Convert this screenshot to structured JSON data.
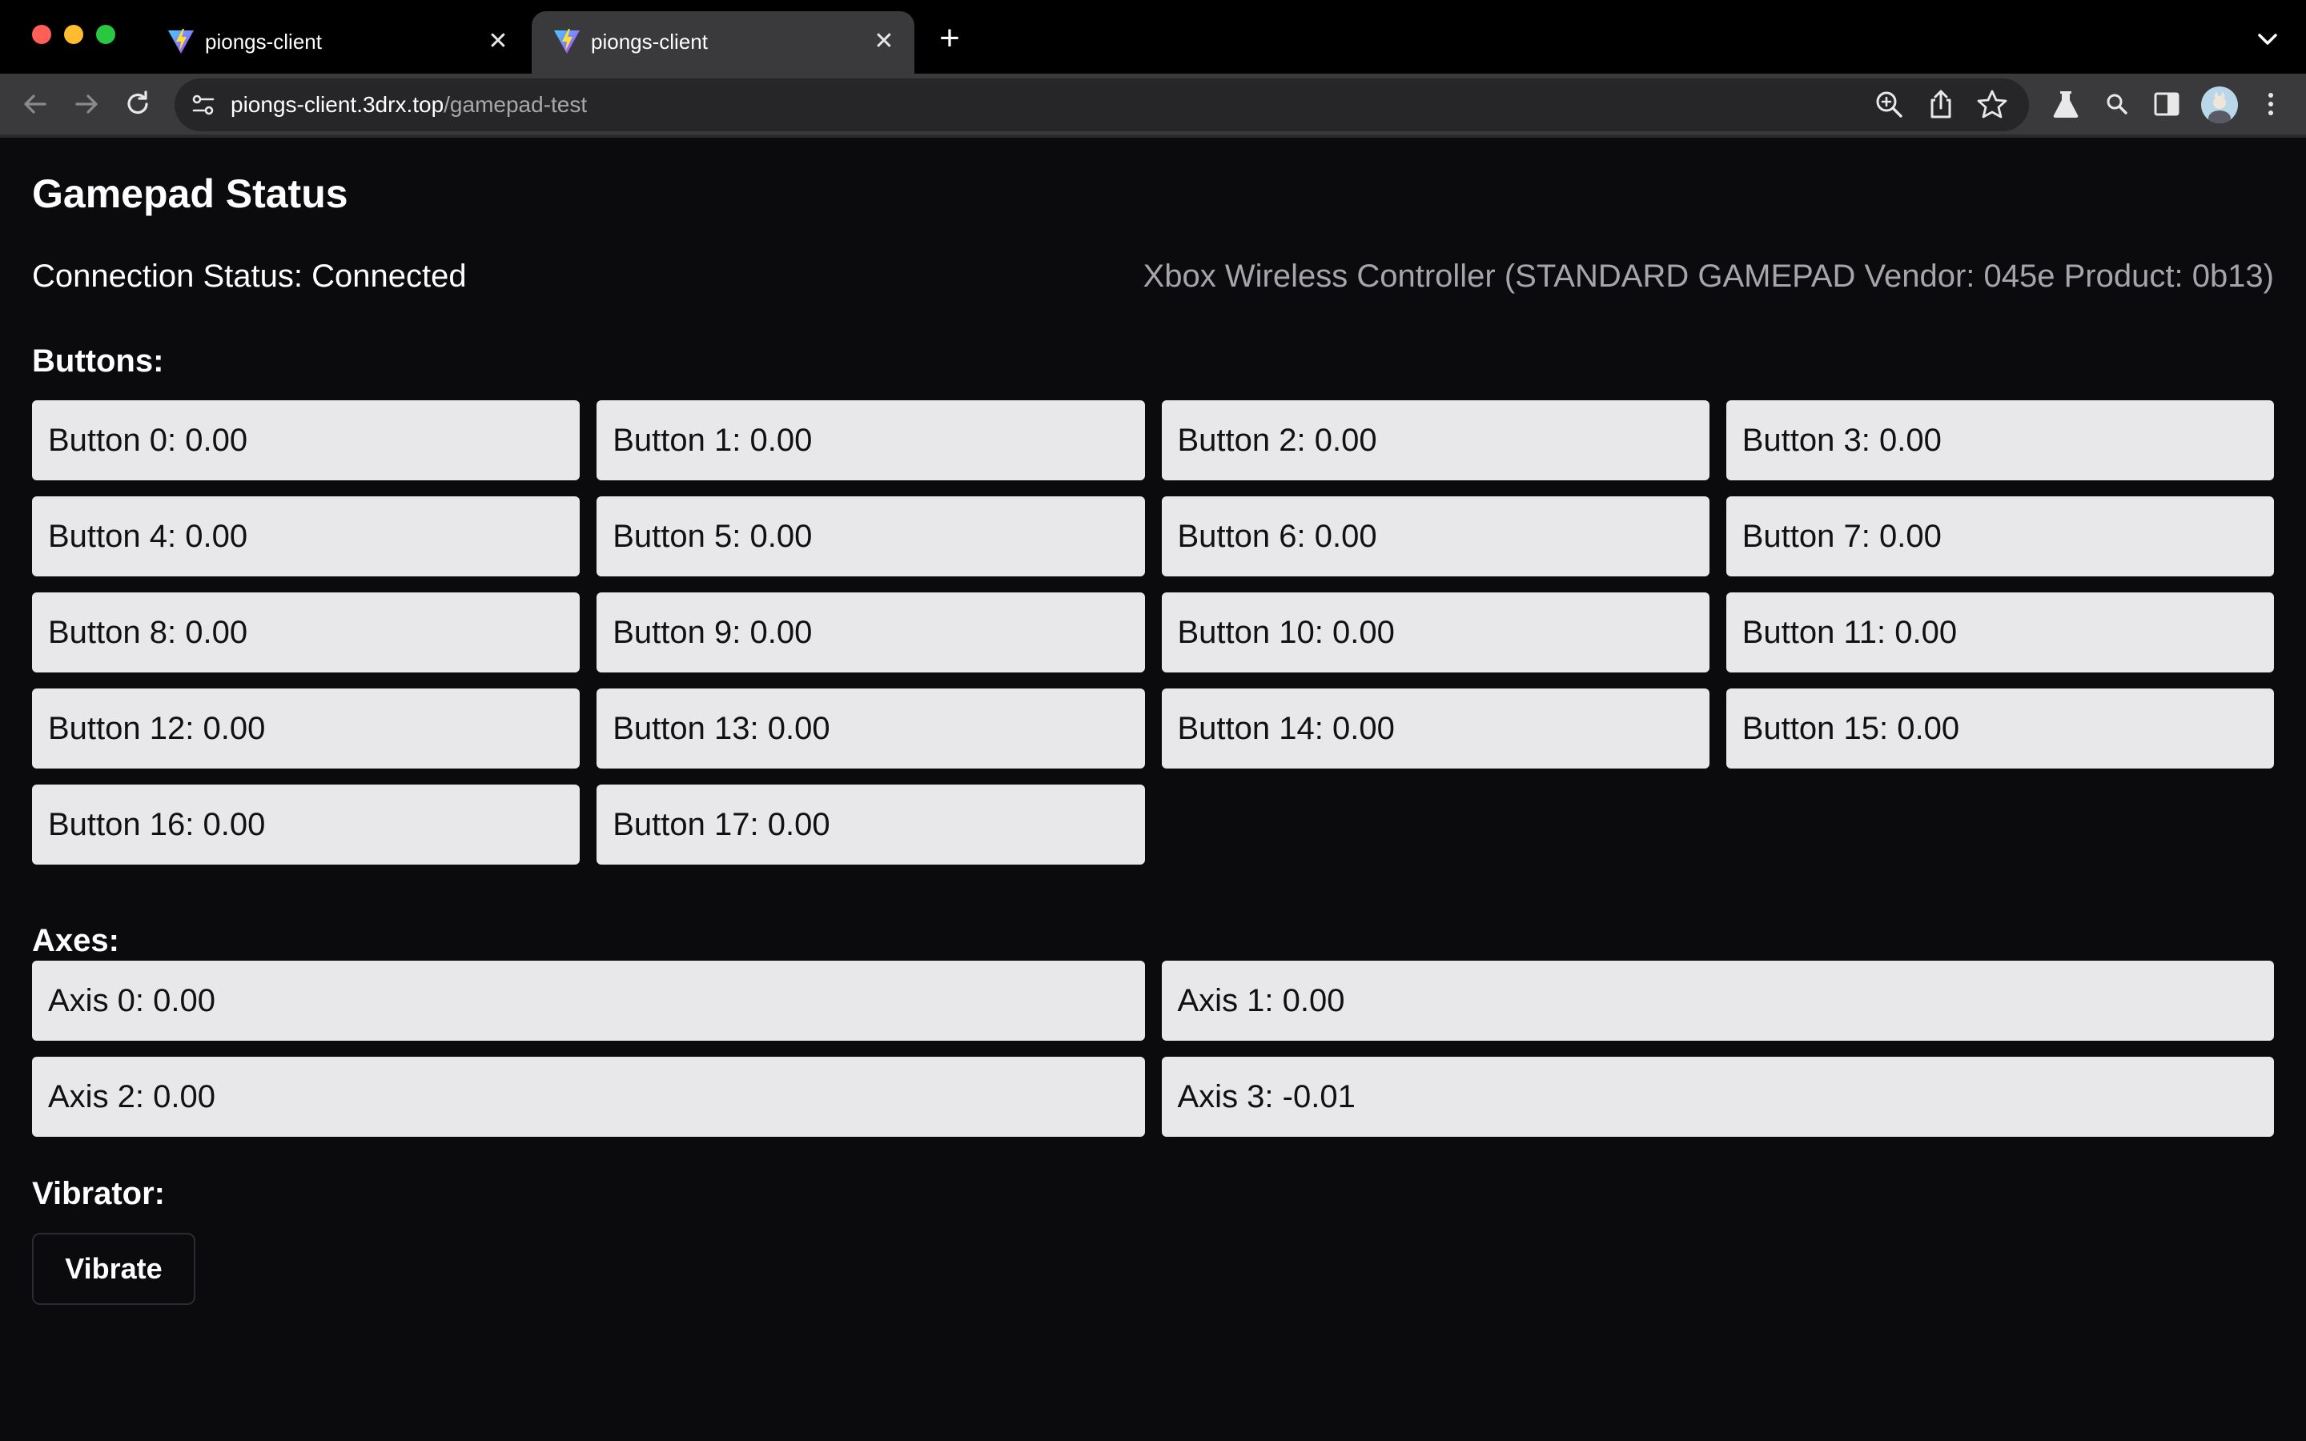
{
  "browser": {
    "tabs": [
      {
        "title": "piongs-client",
        "active": false
      },
      {
        "title": "piongs-client",
        "active": true
      }
    ],
    "address": {
      "host": "piongs-client.3drx.top",
      "path": "/gamepad-test"
    },
    "icons": {
      "back": "arrow-left-icon",
      "forward": "arrow-right-icon",
      "reload": "reload-icon",
      "site_info": "site-settings-icon",
      "zoom": "zoom-icon",
      "share": "share-icon",
      "bookmark": "star-icon",
      "labs": "flask-icon",
      "search": "search-icon",
      "side_panel": "side-panel-icon",
      "profile": "avatar",
      "menu": "kebab-menu-icon"
    },
    "colors": {
      "tabbar": "#000000",
      "toolbar": "#3a3a3c",
      "omnibox": "#262628",
      "close_red": "#ff5f57",
      "minimize_yellow": "#febc2e",
      "zoom_green": "#28c840"
    }
  },
  "page": {
    "title": "Gamepad Status",
    "connection_status": "Connection Status: Connected",
    "device_name": "Xbox Wireless Controller (STANDARD GAMEPAD Vendor: 045e Product: 0b13)",
    "buttons_heading": "Buttons:",
    "buttons": [
      "Button 0: 0.00",
      "Button 1: 0.00",
      "Button 2: 0.00",
      "Button 3: 0.00",
      "Button 4: 0.00",
      "Button 5: 0.00",
      "Button 6: 0.00",
      "Button 7: 0.00",
      "Button 8: 0.00",
      "Button 9: 0.00",
      "Button 10: 0.00",
      "Button 11: 0.00",
      "Button 12: 0.00",
      "Button 13: 0.00",
      "Button 14: 0.00",
      "Button 15: 0.00",
      "Button 16: 0.00",
      "Button 17: 0.00"
    ],
    "axes_heading": "Axes:",
    "axes": [
      "Axis 0: 0.00",
      "Axis 1: 0.00",
      "Axis 2: 0.00",
      "Axis 3: -0.01"
    ],
    "vibrator_heading": "Vibrator:",
    "vibrate_label": "Vibrate",
    "colors": {
      "background": "#0b0b0d",
      "cell_background": "#e8e8ea",
      "cell_text": "#111111",
      "muted_text": "#a6a6aa"
    }
  }
}
